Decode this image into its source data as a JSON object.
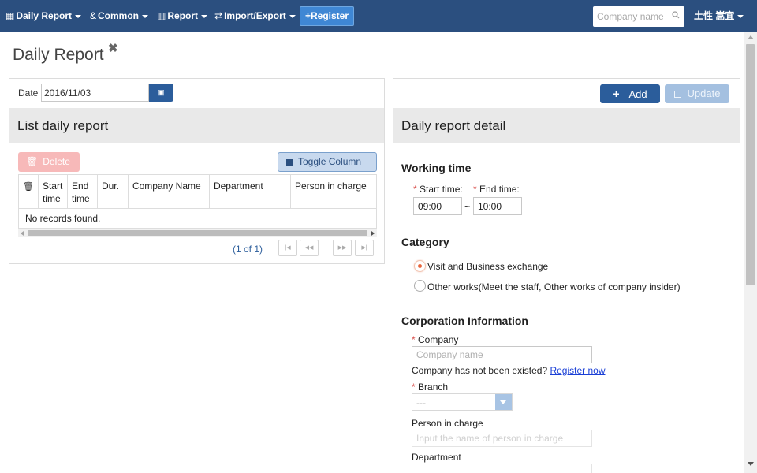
{
  "navbar": {
    "daily_report": "Daily Report",
    "common": "Common",
    "report": "Report",
    "import_export": "Import/Export",
    "register": "Register",
    "search_placeholder": "Company name",
    "user": "土性 嵩宜"
  },
  "page": {
    "title": "Daily Report",
    "close_glyph": "✖"
  },
  "list_panel": {
    "date_label": "Date",
    "date_value": "2016/11/03",
    "title": "List daily report",
    "delete_label": "Delete",
    "toggle_label": "Toggle Column",
    "columns": [
      "Start time",
      "End time",
      "Dur.",
      "Company Name",
      "Department",
      "Person in charge"
    ],
    "empty_message": "No records found.",
    "page_info": "(1 of 1)",
    "pager_first": "|◀",
    "pager_prev": "◀◀",
    "pager_next": "▶▶",
    "pager_last": "▶|"
  },
  "detail_panel": {
    "add_label": "Add",
    "update_label": "Update",
    "title": "Daily report detail",
    "working_time_title": "Working time",
    "start_time_label": "Start time:",
    "end_time_label": "End time:",
    "start_time_value": "09:00",
    "end_time_value": "10:00",
    "time_separator": "~",
    "category_title": "Category",
    "category_options": [
      "Visit and Business exchange",
      "Other works(Meet the staff, Other works of company insider)"
    ],
    "corp_title": "Corporation Information",
    "company_label": "Company",
    "company_placeholder": "Company name",
    "company_not_exist_text": "Company has not been existed?",
    "register_now_link": "Register now",
    "branch_label": "Branch",
    "branch_value": "---",
    "person_label": "Person in charge",
    "person_placeholder": "Input the name of person in charge",
    "department_label": "Department",
    "required_mark": "*"
  },
  "colors": {
    "navbar": "#2b4f7f",
    "primary": "#2b5d9b",
    "danger_disabled": "#f7b9b9",
    "radio_selected": "#e9643a"
  }
}
